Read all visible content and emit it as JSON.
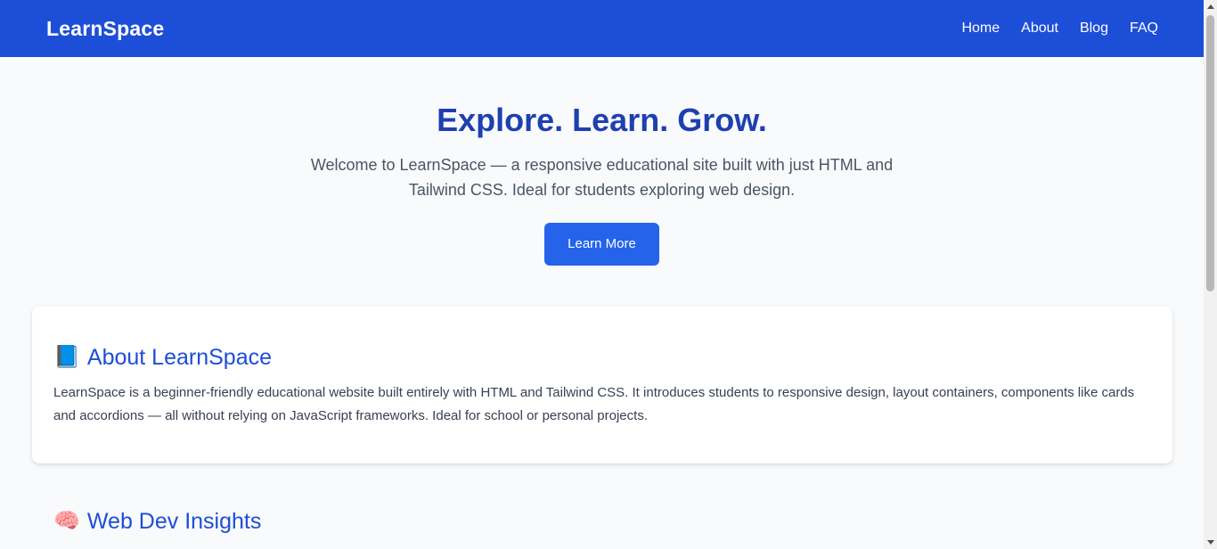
{
  "nav": {
    "brand": "LearnSpace",
    "links": [
      "Home",
      "About",
      "Blog",
      "FAQ"
    ]
  },
  "hero": {
    "title": "Explore. Learn. Grow.",
    "description": "Welcome to LearnSpace — a responsive educational site built with just HTML and Tailwind CSS. Ideal for students exploring web design.",
    "button_label": "Learn More"
  },
  "about": {
    "icon": "📘",
    "title": "About LearnSpace",
    "text": "LearnSpace is a beginner-friendly educational website built entirely with HTML and Tailwind CSS. It introduces students to responsive design, layout containers, components like cards and accordions — all without relying on JavaScript frameworks. Ideal for school or personal projects."
  },
  "insights": {
    "icon": "🧠",
    "title": "Web Dev Insights"
  },
  "colors": {
    "primary": "#1d4ed8",
    "button": "#2563eb",
    "heading": "#1e40af",
    "background": "#f8fafc"
  }
}
